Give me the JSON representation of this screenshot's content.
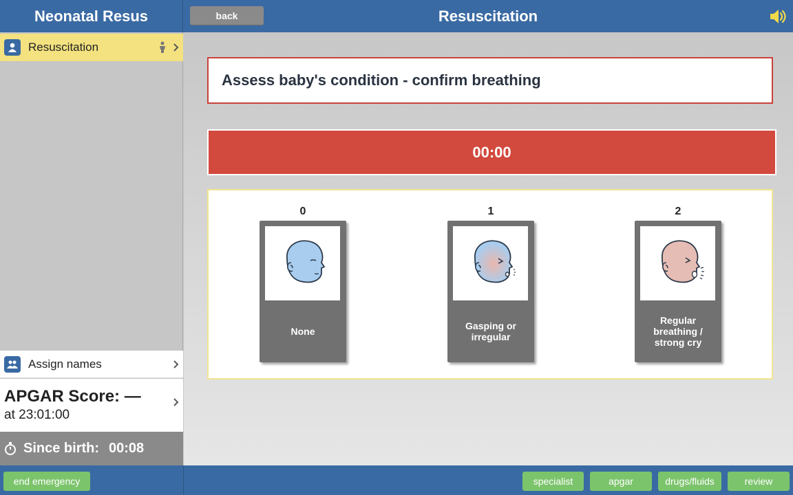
{
  "header": {
    "app_title": "Neonatal Resus",
    "back_label": "back",
    "page_title": "Resuscitation",
    "sound_icon": "speaker-icon"
  },
  "sidebar": {
    "active_item": {
      "label": "Resuscitation",
      "icon": "person-icon",
      "trailing_icon": "child-figure-icon"
    },
    "assign": {
      "label": "Assign names",
      "icon": "people-icon"
    },
    "apgar": {
      "title": "APGAR Score: —",
      "time": "at 23:01:00"
    },
    "since_birth": {
      "label": "Since birth:",
      "value": "00:08",
      "icon": "stopwatch-icon"
    }
  },
  "main": {
    "prompt": "Assess baby's condition - confirm breathing",
    "timer": "00:00",
    "choices": [
      {
        "score": "0",
        "label": "None"
      },
      {
        "score": "1",
        "label": "Gasping or irregular"
      },
      {
        "score": "2",
        "label": "Regular breathing / strong cry"
      }
    ]
  },
  "footer": {
    "end_label": "end emergency",
    "buttons": [
      "specialist",
      "apgar",
      "drugs/fluids",
      "review"
    ]
  },
  "colors": {
    "header_blue": "#3a6aa3",
    "alert_red": "#d2493d",
    "active_yellow": "#f3e27f",
    "button_green": "#7cc46c"
  }
}
